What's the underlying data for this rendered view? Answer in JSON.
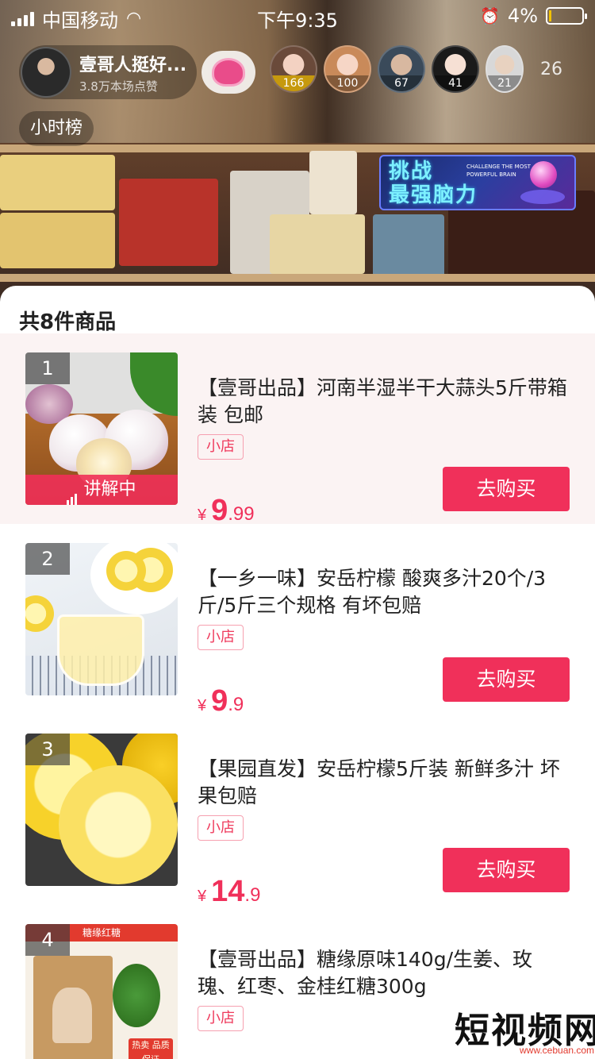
{
  "status_bar": {
    "carrier": "中国移动",
    "time": "下午9:35",
    "battery_percent": "4%",
    "battery_level": 0.04
  },
  "host": {
    "name": "壹哥人挺好...",
    "likes": "3.8万本场点赞"
  },
  "viewers": [
    {
      "count": "166"
    },
    {
      "count": "100"
    },
    {
      "count": "67"
    },
    {
      "count": "41"
    },
    {
      "count": "21"
    }
  ],
  "online_count": "26",
  "hourly_rank_label": "小时榜",
  "challenge_banner": {
    "title_line1": "挑战",
    "title_line2": "最强脑力",
    "subtitle": "CHALLENGE THE MOST POWERFUL BRAIN"
  },
  "sheet": {
    "title": "共8件商品",
    "explaining_label": "讲解中",
    "buy_label": "去购买",
    "shop_label": "小店",
    "currency": "¥"
  },
  "products": [
    {
      "rank": "1",
      "title": "【壹哥出品】河南半湿半干大蒜头5斤带箱装 包邮",
      "price_int": "9",
      "price_dec": ".99",
      "explaining": true
    },
    {
      "rank": "2",
      "title": "【一乡一味】安岳柠檬 酸爽多汁20个/3斤/5斤三个规格 有坏包赔",
      "price_int": "9",
      "price_dec": ".9",
      "explaining": false
    },
    {
      "rank": "3",
      "title": "【果园直发】安岳柠檬5斤装 新鲜多汁 坏果包赔",
      "price_int": "14",
      "price_dec": ".9",
      "explaining": false
    },
    {
      "rank": "4",
      "title": "【壹哥出品】糖缘原味140g/生姜、玫瑰、红枣、金桂红糖300g",
      "price_int": "",
      "price_dec": "",
      "explaining": false,
      "thumb_banner": "糖缘红糖",
      "thumb_tag": "热卖 品质保证"
    }
  ],
  "watermark": {
    "text": "短视频网",
    "url": "www.cebuan.com"
  },
  "colors": {
    "accent": "#f0305a",
    "active_row_bg": "#fbf3f3",
    "battery_low": "#f2c200"
  }
}
